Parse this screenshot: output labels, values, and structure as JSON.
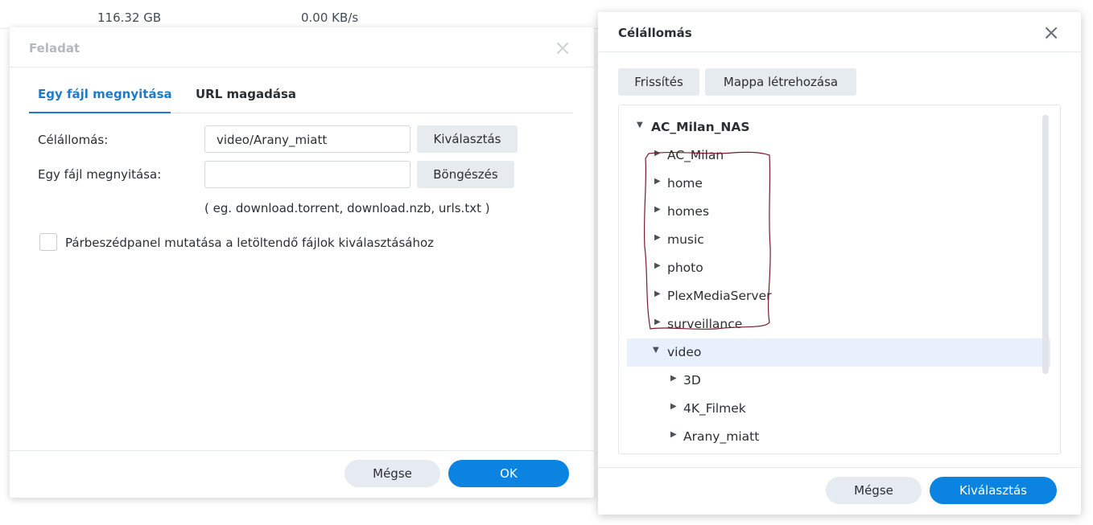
{
  "background_list": {
    "row": {
      "size": "116.32 GB",
      "speed": "0.00 KB/s"
    }
  },
  "task_dialog": {
    "title": "Feladat",
    "close_icon": "close-icon",
    "tabs": [
      {
        "label": "Egy fájl megnyitása",
        "active": true
      },
      {
        "label": "URL magadása",
        "active": false
      }
    ],
    "destination_label": "Célállomás:",
    "destination_value": "video/Arany_miatt",
    "select_button": "Kiválasztás",
    "open_file_label": "Egy fájl megnyitása:",
    "open_file_value": "",
    "browse_button": "Böngészés",
    "hint": "( eg. download.torrent, download.nzb, urls.txt )",
    "checkbox_label": "Párbeszédpanel mutatása a letöltendő fájlok kiválasztásához",
    "checkbox_checked": false,
    "cancel_button": "Mégse",
    "ok_button": "OK"
  },
  "dest_dialog": {
    "title": "Célállomás",
    "close_icon": "close-icon",
    "refresh_button": "Frissítés",
    "create_folder_button": "Mappa létrehozása",
    "tree": {
      "root": "AC_Milan_NAS",
      "items": [
        "AC_Milan",
        "home",
        "homes",
        "music",
        "photo",
        "PlexMediaServer",
        "surveillance"
      ],
      "expanded": "video",
      "children": [
        "3D",
        "4K_Filmek",
        "Arany_miatt"
      ]
    },
    "cancel_button": "Mégse",
    "select_button": "Kiválasztás"
  },
  "colors": {
    "accent": "#1f7bc8",
    "primary_button": "#0a84e0",
    "selected_row": "#e8f1fb",
    "annotation": "#7a1a2a"
  }
}
